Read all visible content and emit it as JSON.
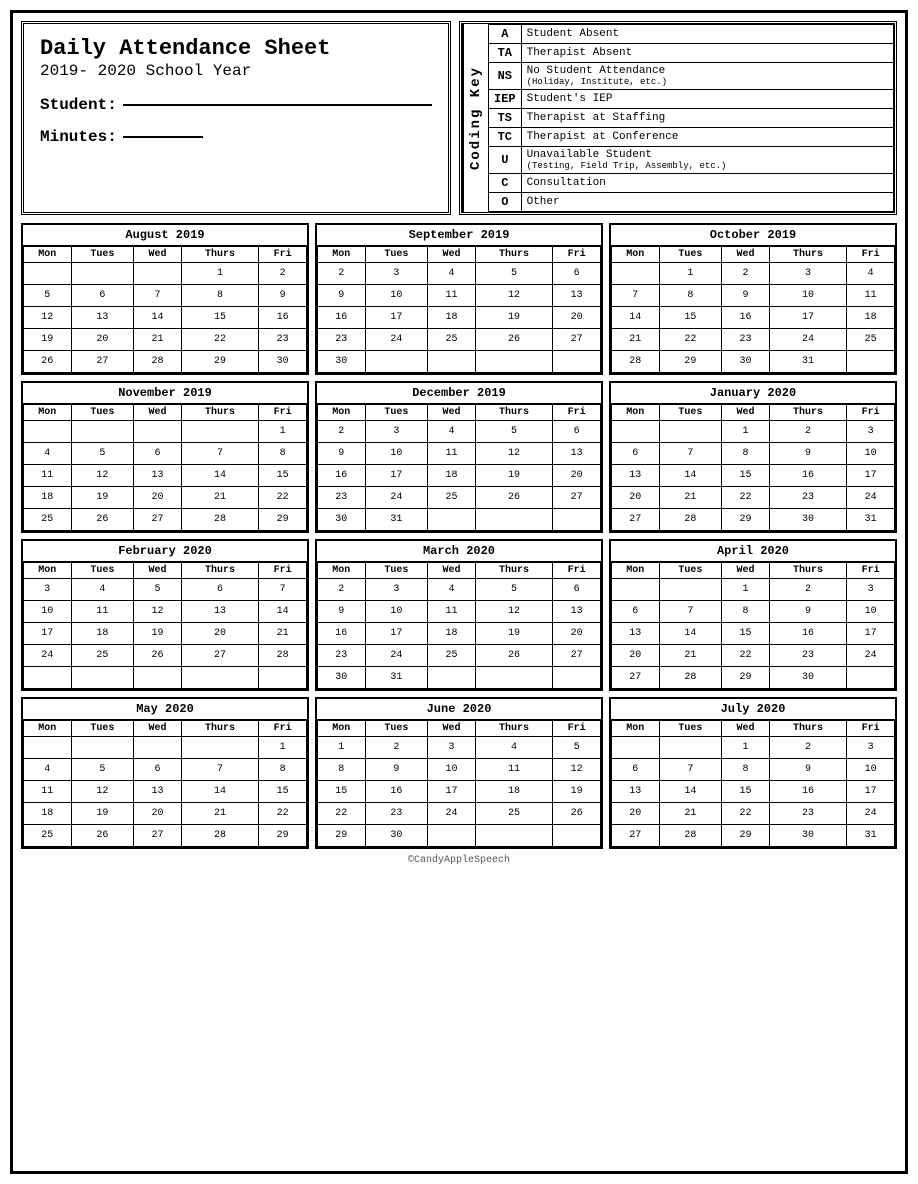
{
  "header": {
    "title": "Daily Attendance Sheet",
    "subtitle": "2019- 2020 School Year",
    "student_label": "Student:",
    "minutes_label": "Minutes:"
  },
  "coding_key": {
    "label": "Coding Key",
    "items": [
      {
        "code": "A",
        "description": "Student Absent",
        "sub": ""
      },
      {
        "code": "TA",
        "description": "Therapist Absent",
        "sub": ""
      },
      {
        "code": "NS",
        "description": "No Student Attendance",
        "sub": "(Holiday, Institute, etc.)"
      },
      {
        "code": "IEP",
        "description": "Student's IEP",
        "sub": ""
      },
      {
        "code": "TS",
        "description": "Therapist at Staffing",
        "sub": ""
      },
      {
        "code": "TC",
        "description": "Therapist at Conference",
        "sub": ""
      },
      {
        "code": "U",
        "description": "Unavailable Student",
        "sub": "(Testing, Field Trip, Assembly, etc.)"
      },
      {
        "code": "C",
        "description": "Consultation",
        "sub": ""
      },
      {
        "code": "O",
        "description": "Other",
        "sub": ""
      }
    ]
  },
  "calendars": [
    {
      "title": "August 2019",
      "days": [
        "Mon",
        "Tues",
        "Wed",
        "Thurs",
        "Fri"
      ],
      "weeks": [
        [
          "",
          "",
          "",
          "1",
          "2"
        ],
        [
          "5",
          "6",
          "7",
          "8",
          "9"
        ],
        [
          "12",
          "13",
          "14",
          "15",
          "16"
        ],
        [
          "19",
          "20",
          "21",
          "22",
          "23"
        ],
        [
          "26",
          "27",
          "28",
          "29",
          "30"
        ]
      ]
    },
    {
      "title": "September 2019",
      "days": [
        "Mon",
        "Tues",
        "Wed",
        "Thurs",
        "Fri"
      ],
      "weeks": [
        [
          "2",
          "3",
          "4",
          "5",
          "6"
        ],
        [
          "9",
          "10",
          "11",
          "12",
          "13"
        ],
        [
          "16",
          "17",
          "18",
          "19",
          "20"
        ],
        [
          "23",
          "24",
          "25",
          "26",
          "27"
        ],
        [
          "30",
          "",
          "",
          "",
          ""
        ]
      ]
    },
    {
      "title": "October 2019",
      "days": [
        "Mon",
        "Tues",
        "Wed",
        "Thurs",
        "Fri"
      ],
      "weeks": [
        [
          "",
          "1",
          "2",
          "3",
          "4"
        ],
        [
          "7",
          "8",
          "9",
          "10",
          "11"
        ],
        [
          "14",
          "15",
          "16",
          "17",
          "18"
        ],
        [
          "21",
          "22",
          "23",
          "24",
          "25"
        ],
        [
          "28",
          "29",
          "30",
          "31",
          ""
        ]
      ]
    },
    {
      "title": "November 2019",
      "days": [
        "Mon",
        "Tues",
        "Wed",
        "Thurs",
        "Fri"
      ],
      "weeks": [
        [
          "",
          "",
          "",
          "",
          "1"
        ],
        [
          "4",
          "5",
          "6",
          "7",
          "8"
        ],
        [
          "11",
          "12",
          "13",
          "14",
          "15"
        ],
        [
          "18",
          "19",
          "20",
          "21",
          "22"
        ],
        [
          "25",
          "26",
          "27",
          "28",
          "29"
        ]
      ]
    },
    {
      "title": "December 2019",
      "days": [
        "Mon",
        "Tues",
        "Wed",
        "Thurs",
        "Fri"
      ],
      "weeks": [
        [
          "2",
          "3",
          "4",
          "5",
          "6"
        ],
        [
          "9",
          "10",
          "11",
          "12",
          "13"
        ],
        [
          "16",
          "17",
          "18",
          "19",
          "20"
        ],
        [
          "23",
          "24",
          "25",
          "26",
          "27"
        ],
        [
          "30",
          "31",
          "",
          "",
          ""
        ]
      ]
    },
    {
      "title": "January 2020",
      "days": [
        "Mon",
        "Tues",
        "Wed",
        "Thurs",
        "Fri"
      ],
      "weeks": [
        [
          "",
          "",
          "1",
          "2",
          "3"
        ],
        [
          "6",
          "7",
          "8",
          "9",
          "10"
        ],
        [
          "13",
          "14",
          "15",
          "16",
          "17"
        ],
        [
          "20",
          "21",
          "22",
          "23",
          "24"
        ],
        [
          "27",
          "28",
          "29",
          "30",
          "31"
        ]
      ]
    },
    {
      "title": "February 2020",
      "days": [
        "Mon",
        "Tues",
        "Wed",
        "Thurs",
        "Fri"
      ],
      "weeks": [
        [
          "3",
          "4",
          "5",
          "6",
          "7"
        ],
        [
          "10",
          "11",
          "12",
          "13",
          "14"
        ],
        [
          "17",
          "18",
          "19",
          "20",
          "21"
        ],
        [
          "24",
          "25",
          "26",
          "27",
          "28"
        ],
        [
          "",
          "",
          "",
          "",
          ""
        ]
      ]
    },
    {
      "title": "March 2020",
      "days": [
        "Mon",
        "Tues",
        "Wed",
        "Thurs",
        "Fri"
      ],
      "weeks": [
        [
          "2",
          "3",
          "4",
          "5",
          "6"
        ],
        [
          "9",
          "10",
          "11",
          "12",
          "13"
        ],
        [
          "16",
          "17",
          "18",
          "19",
          "20"
        ],
        [
          "23",
          "24",
          "25",
          "26",
          "27"
        ],
        [
          "30",
          "31",
          "",
          "",
          ""
        ]
      ]
    },
    {
      "title": "April 2020",
      "days": [
        "Mon",
        "Tues",
        "Wed",
        "Thurs",
        "Fri"
      ],
      "weeks": [
        [
          "",
          "",
          "1",
          "2",
          "3"
        ],
        [
          "6",
          "7",
          "8",
          "9",
          "10"
        ],
        [
          "13",
          "14",
          "15",
          "16",
          "17"
        ],
        [
          "20",
          "21",
          "22",
          "23",
          "24"
        ],
        [
          "27",
          "28",
          "29",
          "30",
          ""
        ]
      ]
    },
    {
      "title": "May 2020",
      "days": [
        "Mon",
        "Tues",
        "Wed",
        "Thurs",
        "Fri"
      ],
      "weeks": [
        [
          "",
          "",
          "",
          "",
          "1"
        ],
        [
          "4",
          "5",
          "6",
          "7",
          "8"
        ],
        [
          "11",
          "12",
          "13",
          "14",
          "15"
        ],
        [
          "18",
          "19",
          "20",
          "21",
          "22"
        ],
        [
          "25",
          "26",
          "27",
          "28",
          "29"
        ]
      ]
    },
    {
      "title": "June 2020",
      "days": [
        "Mon",
        "Tues",
        "Wed",
        "Thurs",
        "Fri"
      ],
      "weeks": [
        [
          "1",
          "2",
          "3",
          "4",
          "5"
        ],
        [
          "8",
          "9",
          "10",
          "11",
          "12"
        ],
        [
          "15",
          "16",
          "17",
          "18",
          "19"
        ],
        [
          "22",
          "23",
          "24",
          "25",
          "26"
        ],
        [
          "29",
          "30",
          "",
          "",
          ""
        ]
      ]
    },
    {
      "title": "July 2020",
      "days": [
        "Mon",
        "Tues",
        "Wed",
        "Thurs",
        "Fri"
      ],
      "weeks": [
        [
          "",
          "",
          "1",
          "2",
          "3"
        ],
        [
          "6",
          "7",
          "8",
          "9",
          "10"
        ],
        [
          "13",
          "14",
          "15",
          "16",
          "17"
        ],
        [
          "20",
          "21",
          "22",
          "23",
          "24"
        ],
        [
          "27",
          "28",
          "29",
          "30",
          "31"
        ]
      ]
    }
  ],
  "footer": "©CandyAppleSpeech"
}
